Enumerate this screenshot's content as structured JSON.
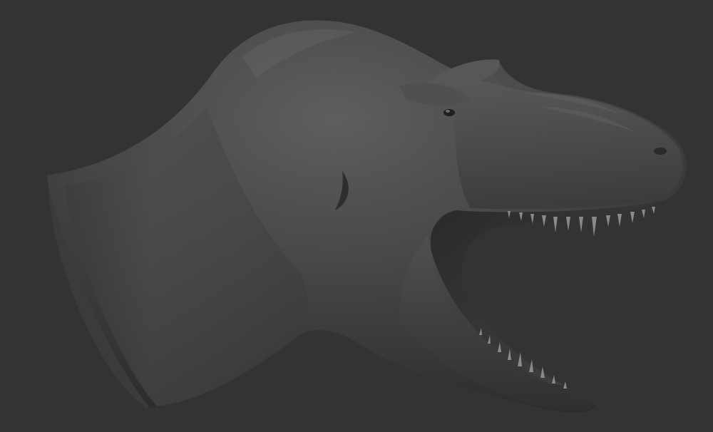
{
  "viewport": {
    "background_color": "#333333",
    "model": {
      "subject": "t-rex-head-bust",
      "material_color": "#4a4a4a",
      "highlight_color": "#6a6a6a",
      "shadow_color": "#262626",
      "mouth_interior_color": "#3f3f3f",
      "teeth_color": "#8a8a8a"
    }
  }
}
